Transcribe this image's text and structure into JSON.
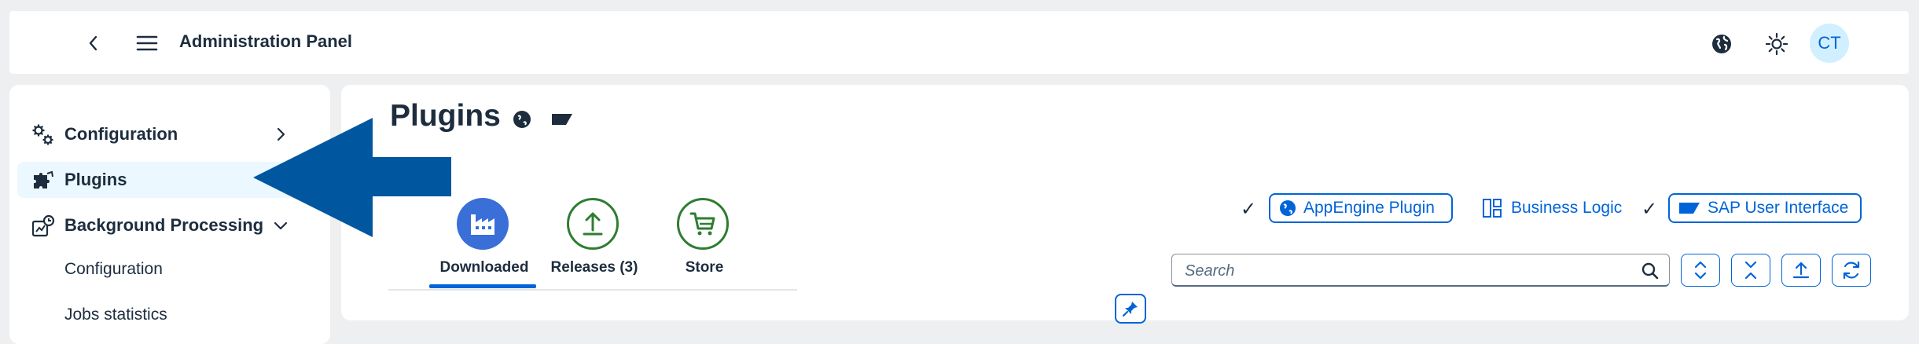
{
  "shell": {
    "title": "Administration Panel",
    "avatar_initials": "CT"
  },
  "sidebar": {
    "items": [
      {
        "label": "Configuration",
        "icon": "gears-icon"
      },
      {
        "label": "Plugins",
        "icon": "puzzle-icon",
        "selected": true
      },
      {
        "label": "Background Processing",
        "icon": "background-process-icon"
      },
      {
        "label": "Configuration",
        "sub": true
      },
      {
        "label": "Jobs statistics",
        "sub": true
      }
    ]
  },
  "page": {
    "title": "Plugins"
  },
  "tabs": [
    {
      "label": "Downloaded",
      "icon": "factory-icon",
      "selected": true
    },
    {
      "label": "Releases (3)",
      "icon": "upload-icon"
    },
    {
      "label": "Store",
      "icon": "cart-icon"
    }
  ],
  "filters": {
    "appengine": "AppEngine Plugin",
    "business_logic": "Business Logic",
    "sap_ui": "SAP User Interface"
  },
  "search": {
    "placeholder": "Search"
  },
  "colors": {
    "accent": "#0064d9",
    "positive": "#2e7d32",
    "arrow": "#0057a0",
    "background": "#edeff0"
  }
}
